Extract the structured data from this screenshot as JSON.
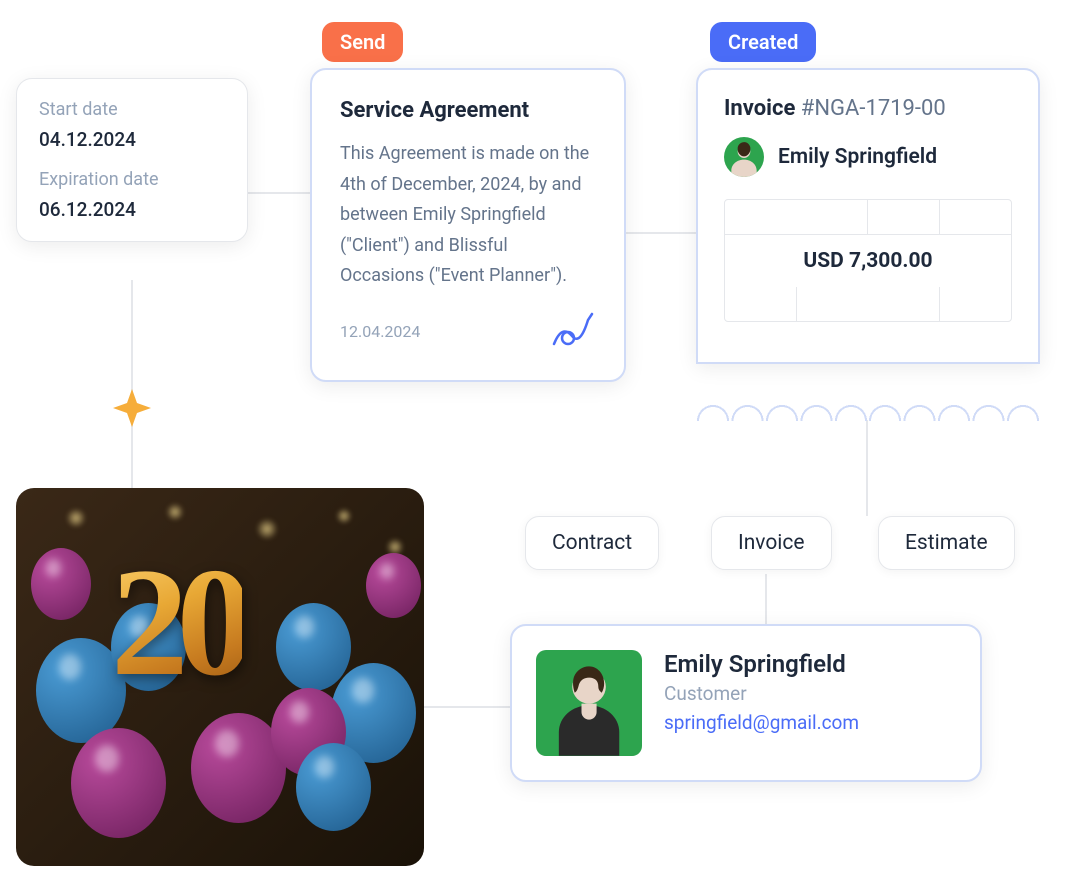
{
  "badges": {
    "send": "Send",
    "created": "Created"
  },
  "dates": {
    "start_label": "Start date",
    "start_value": "04.12.2024",
    "expiration_label": "Expiration date",
    "expiration_value": "06.12.2024"
  },
  "agreement": {
    "title": "Service Agreement",
    "body": "This Agreement is made on the 4th of December, 2024, by and between Emily Springfield (\"Client\") and Blissful Occasions (\"Event Planner\").",
    "date": "12.04.2024"
  },
  "invoice": {
    "label": "Invoice",
    "number": "#NGA-1719-00",
    "person": "Emily Springfield",
    "amount": "USD 7,300.00"
  },
  "pills": {
    "contract": "Contract",
    "invoice": "Invoice",
    "estimate": "Estimate"
  },
  "customer": {
    "name": "Emily Springfield",
    "role": "Customer",
    "email": "springfield@gmail.com"
  },
  "event_image": {
    "number": "20"
  }
}
